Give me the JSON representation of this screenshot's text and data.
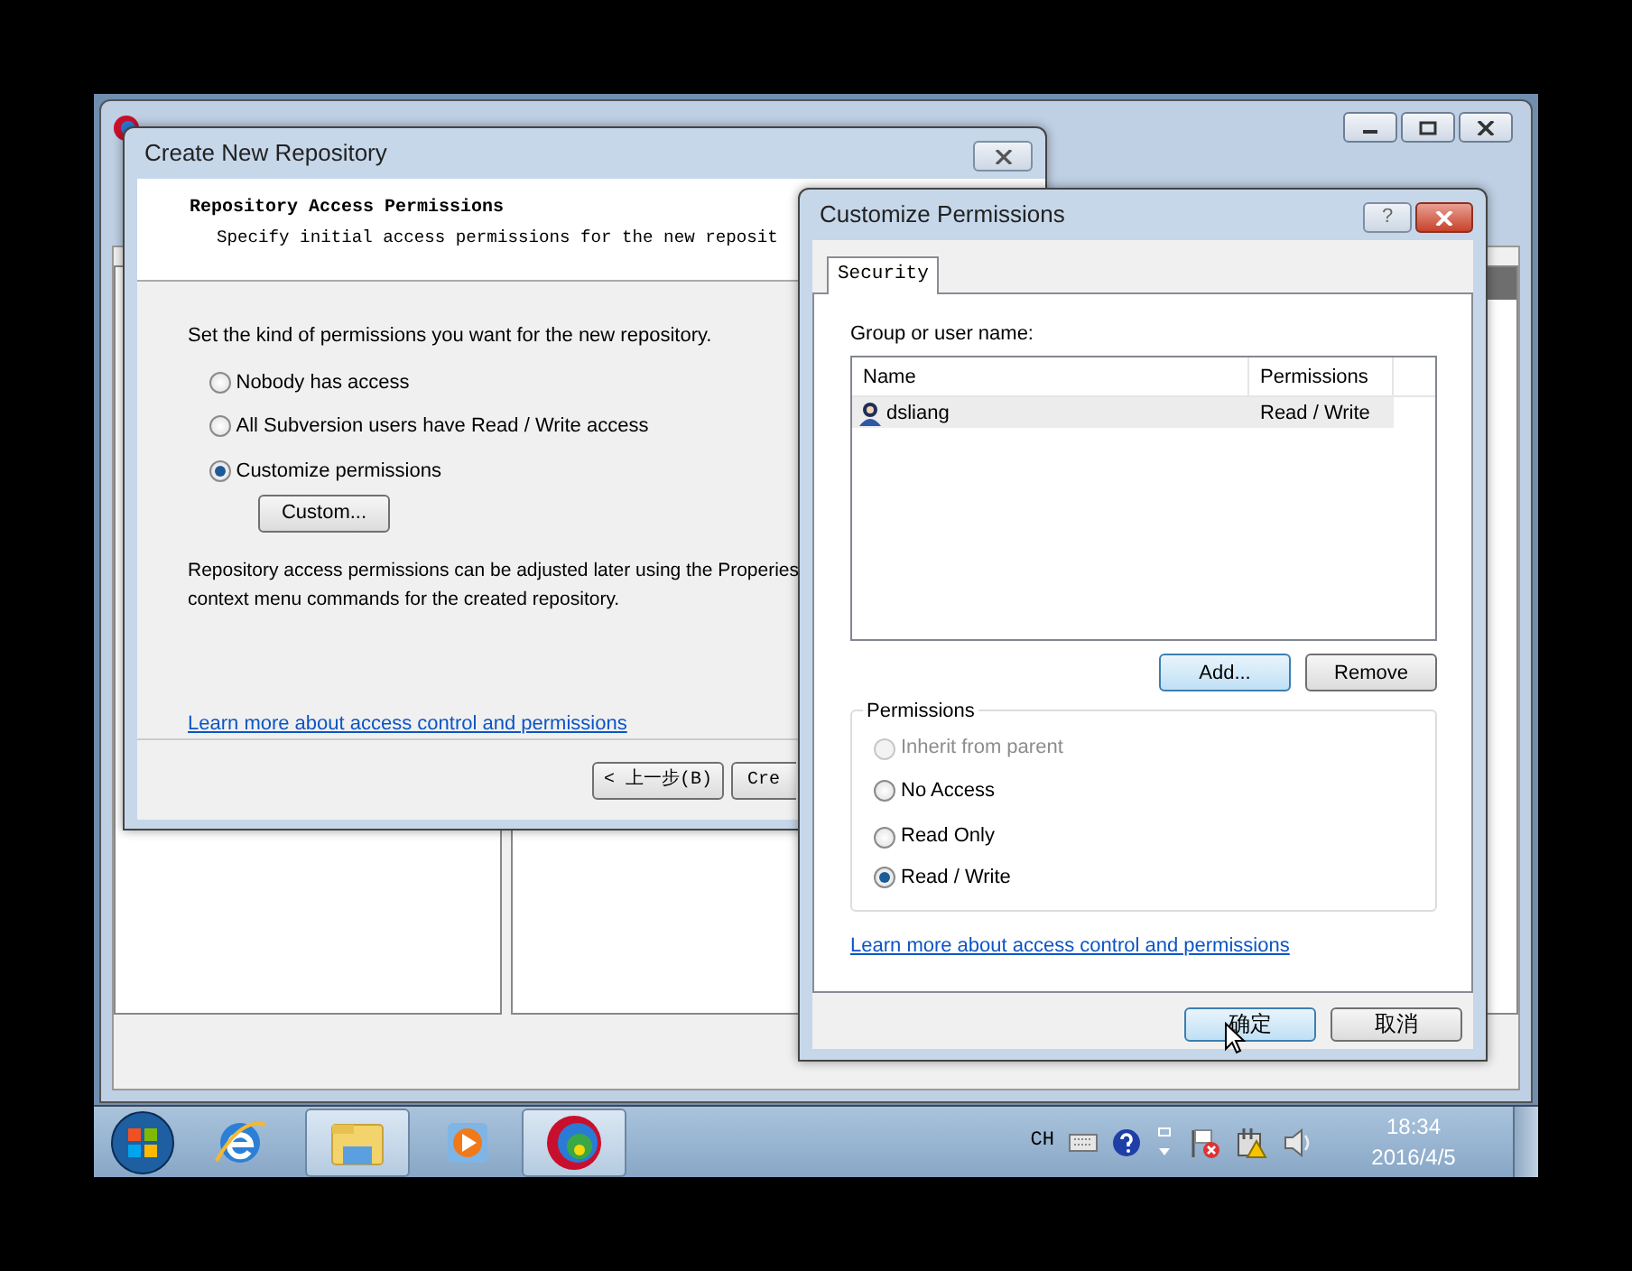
{
  "create_dialog": {
    "title": "Create New Repository",
    "header_title": "Repository Access Permissions",
    "header_subtitle": "Specify initial access permissions for the new reposit",
    "prompt": "Set the kind of permissions you want for the new repository.",
    "options": [
      {
        "label": "Nobody has access",
        "selected": false
      },
      {
        "label": "All Subversion users have Read / Write access",
        "selected": false
      },
      {
        "label": "Customize permissions",
        "selected": true
      }
    ],
    "custom_button": "Custom...",
    "note_lines": [
      "Repository access permissions can be adjusted later using the Properies",
      "context menu commands for the created repository."
    ],
    "link": "Learn more about access control and permissions",
    "buttons": [
      "< 上一步(B)",
      "Cre"
    ]
  },
  "customize_dialog": {
    "title": "Customize Permissions",
    "help_button": "?",
    "tabs": [
      {
        "label": "Security",
        "selected": true
      }
    ],
    "group_label": "Group or user name:",
    "columns": [
      "Name",
      "Permissions"
    ],
    "rows": [
      {
        "name": "dsliang",
        "permission": "Read / Write",
        "selected": true
      }
    ],
    "list_buttons": [
      "Add...",
      "Remove"
    ],
    "permissions": {
      "legend": "Permissions",
      "options": [
        {
          "label": "Inherit from parent",
          "selected": false,
          "disabled": true
        },
        {
          "label": "No Access",
          "selected": false,
          "disabled": false
        },
        {
          "label": "Read Only",
          "selected": false,
          "disabled": false
        },
        {
          "label": "Read / Write",
          "selected": true,
          "disabled": false
        }
      ]
    },
    "link": "Learn more about access control and permissions",
    "buttons": [
      "确定",
      "取消"
    ]
  },
  "taskbar": {
    "language": "CH",
    "time": "18:34",
    "date": "2016/4/5"
  }
}
